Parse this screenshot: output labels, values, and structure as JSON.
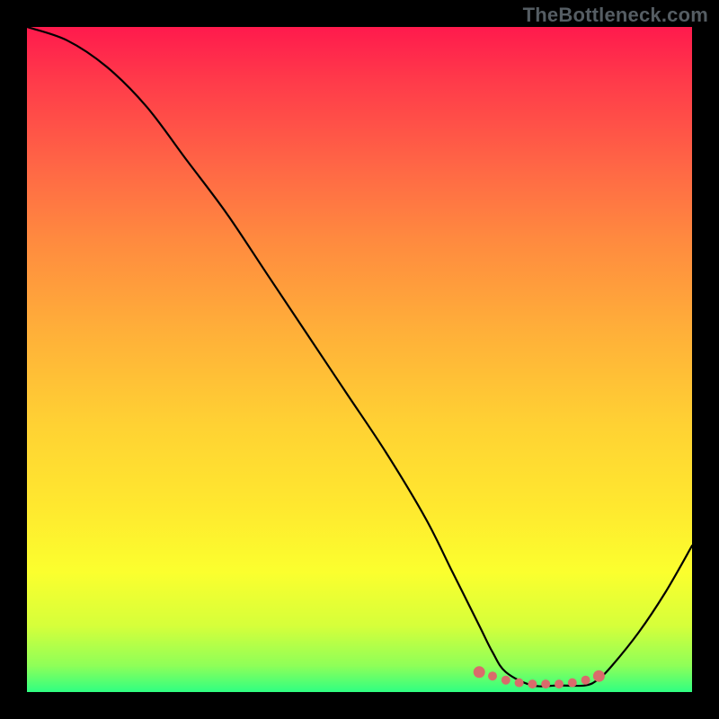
{
  "watermark": "TheBottleneck.com",
  "chart_data": {
    "type": "line",
    "title": "",
    "xlabel": "",
    "ylabel": "",
    "xlim": [
      0,
      100
    ],
    "ylim": [
      0,
      100
    ],
    "series": [
      {
        "name": "curve",
        "x": [
          0,
          6,
          12,
          18,
          24,
          30,
          36,
          42,
          48,
          54,
          60,
          64,
          68,
          70,
          72,
          76,
          80,
          84,
          86,
          88,
          92,
          96,
          100
        ],
        "values": [
          100,
          98,
          94,
          88,
          80,
          72,
          63,
          54,
          45,
          36,
          26,
          18,
          10,
          6,
          3,
          1,
          1,
          1,
          2,
          4,
          9,
          15,
          22
        ]
      },
      {
        "name": "marker-band",
        "x": [
          68,
          70,
          72,
          74,
          76,
          78,
          80,
          82,
          84,
          86
        ],
        "values": [
          3,
          2.4,
          1.8,
          1.4,
          1.2,
          1.2,
          1.2,
          1.4,
          1.8,
          2.4
        ]
      }
    ],
    "gradient_stops": [
      {
        "pos": 0.0,
        "color": "#ff1a4d"
      },
      {
        "pos": 0.08,
        "color": "#ff3a4a"
      },
      {
        "pos": 0.22,
        "color": "#ff6a45"
      },
      {
        "pos": 0.32,
        "color": "#ff8a3f"
      },
      {
        "pos": 0.46,
        "color": "#ffb039"
      },
      {
        "pos": 0.6,
        "color": "#ffd233"
      },
      {
        "pos": 0.72,
        "color": "#ffe82f"
      },
      {
        "pos": 0.82,
        "color": "#fbff2e"
      },
      {
        "pos": 0.9,
        "color": "#d6ff3a"
      },
      {
        "pos": 0.96,
        "color": "#8fff58"
      },
      {
        "pos": 1.0,
        "color": "#2fff82"
      }
    ],
    "marker_color": "#d96b6b",
    "curve_color": "#000000"
  }
}
